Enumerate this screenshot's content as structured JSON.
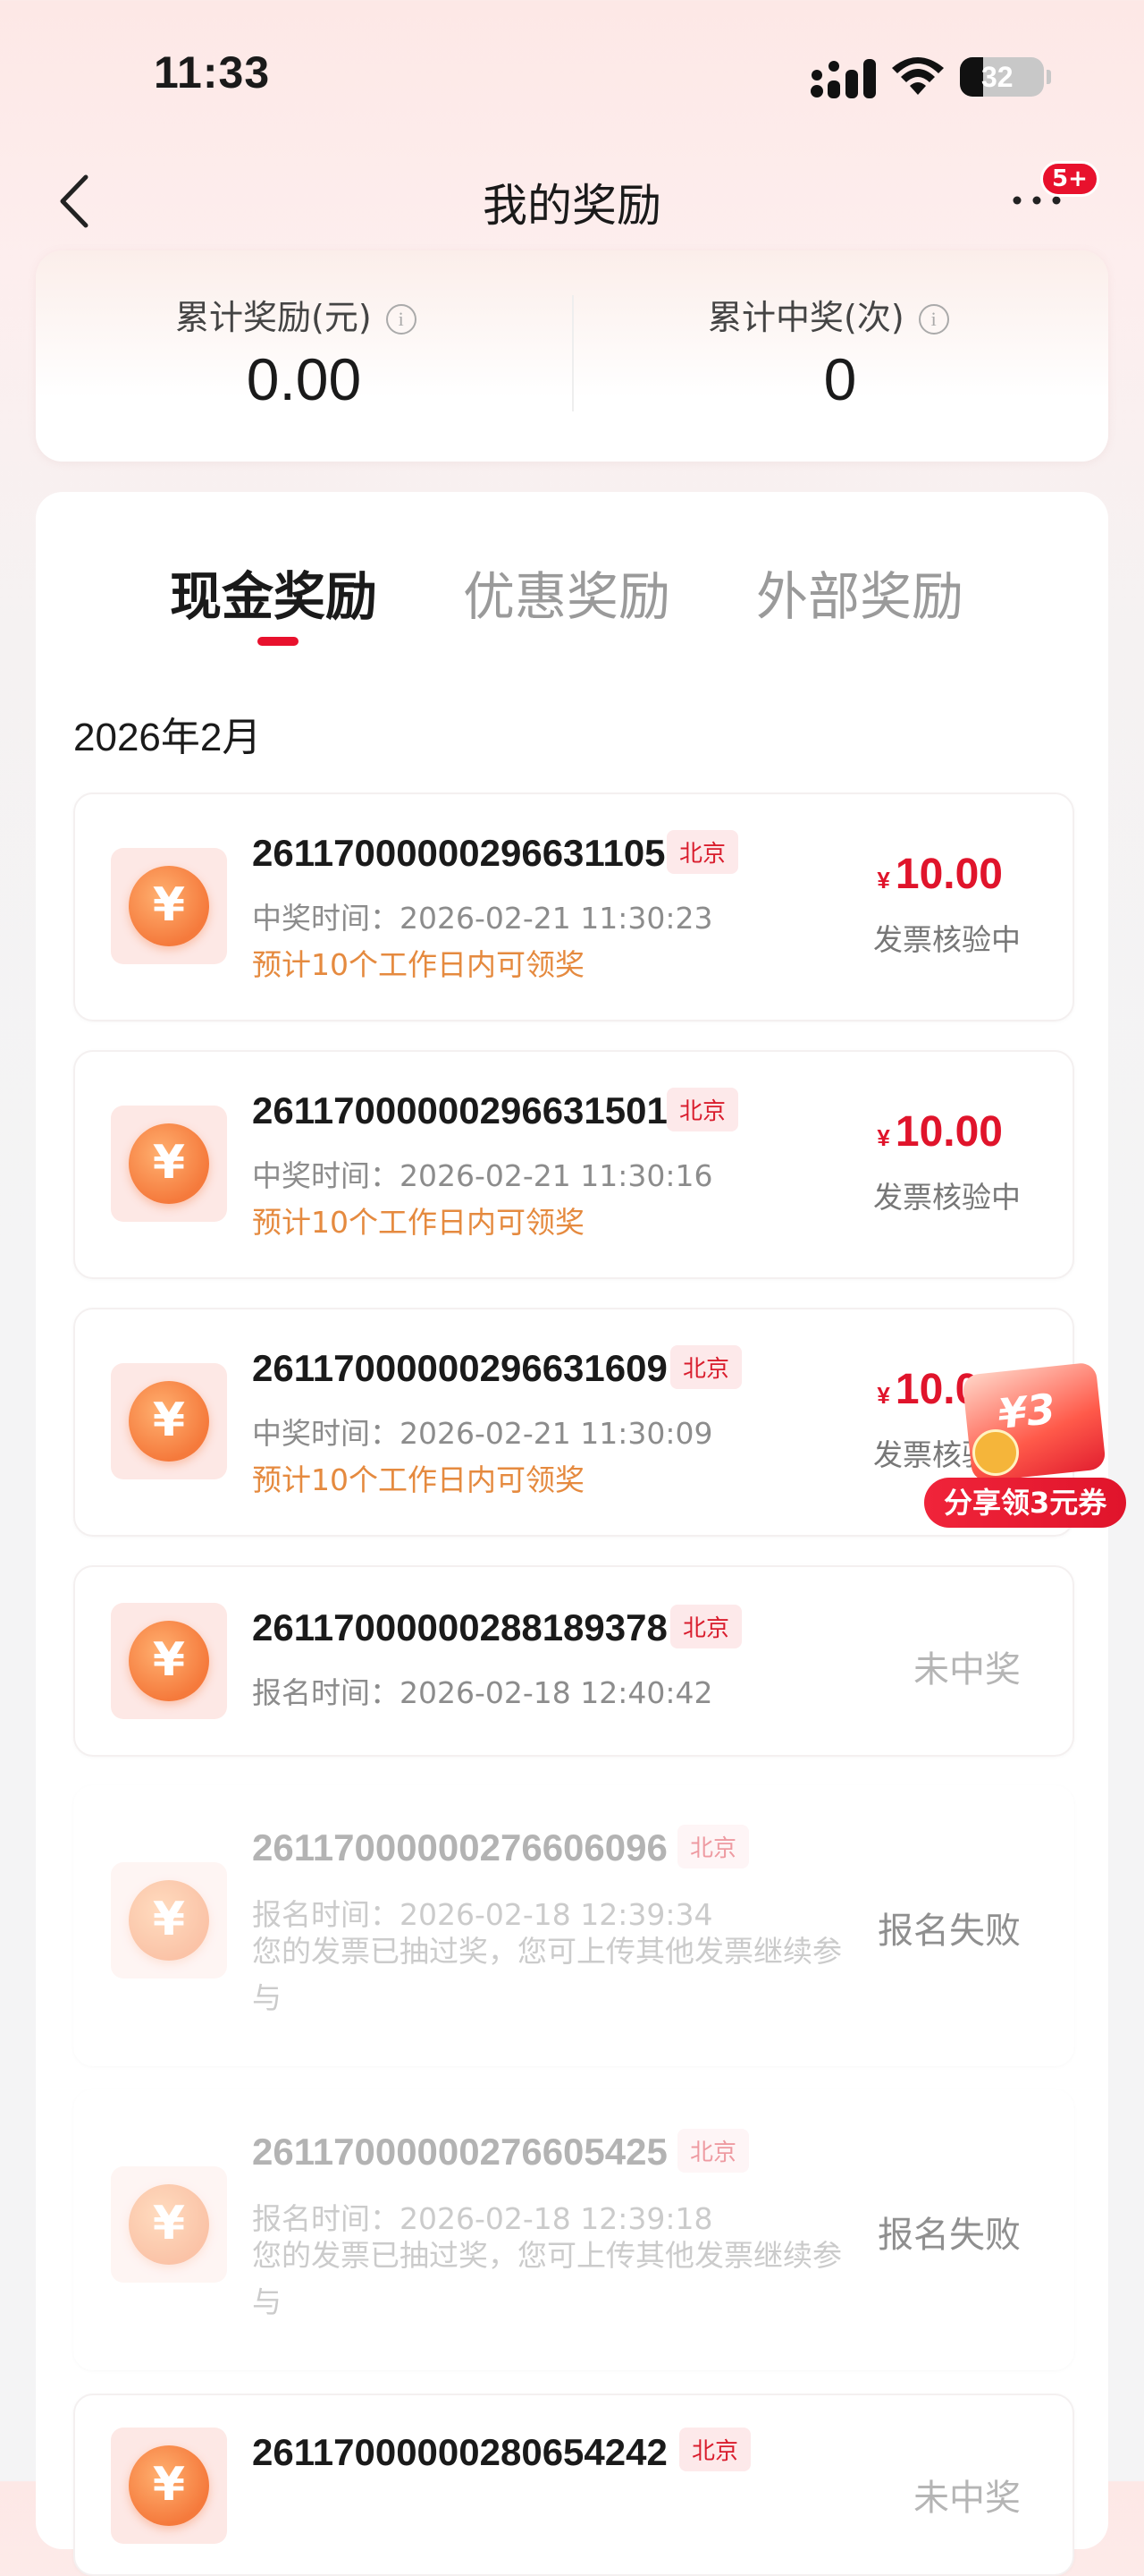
{
  "status_bar": {
    "time": "11:33",
    "battery": "32"
  },
  "nav": {
    "title": "我的奖励",
    "more_badge": "5+"
  },
  "summary": {
    "total_reward_label": "累计奖励(元)",
    "total_reward_value": "0.00",
    "total_wins_label": "累计中奖(次)",
    "total_wins_value": "0",
    "info_glyph": "i"
  },
  "tabs": [
    {
      "label": "现金奖励",
      "active": true
    },
    {
      "label": "优惠奖励",
      "active": false
    },
    {
      "label": "外部奖励",
      "active": false
    }
  ],
  "month": "2026年2月",
  "currency_symbol": "¥",
  "coin_glyph": "¥",
  "records": [
    {
      "id": "26117000000296631105",
      "city": "北京",
      "time_label": "中奖时间：",
      "time": "2026-02-21 11:30:23",
      "note": "预计10个工作日内可领奖",
      "amount": "10.00",
      "status": "发票核验中"
    },
    {
      "id": "26117000000296631501",
      "city": "北京",
      "time_label": "中奖时间：",
      "time": "2026-02-21 11:30:16",
      "note": "预计10个工作日内可领奖",
      "amount": "10.00",
      "status": "发票核验中"
    },
    {
      "id": "26117000000296631609",
      "city": "北京",
      "time_label": "中奖时间：",
      "time": "2026-02-21 11:30:09",
      "note": "预计10个工作日内可领奖",
      "amount": "10.00",
      "status": "发票核验中"
    },
    {
      "id": "26117000000288189378",
      "city": "北京",
      "time_label": "报名时间：",
      "time": "2026-02-18 12:40:42",
      "status": "未中奖"
    },
    {
      "id": "26117000000276606096",
      "city": "北京",
      "time_label": "报名时间：",
      "time": "2026-02-18 12:39:34",
      "note": "您的发票已抽过奖，您可上传其他发票继续参与",
      "status": "报名失败"
    },
    {
      "id": "26117000000276605425",
      "city": "北京",
      "time_label": "报名时间：",
      "time": "2026-02-18 12:39:18",
      "note": "您的发票已抽过奖，您可上传其他发票继续参与",
      "status": "报名失败"
    },
    {
      "id": "26117000000280654242",
      "city": "北京",
      "status": "未中奖"
    }
  ],
  "promo": {
    "gift_text": "¥3",
    "label": "分享领3元券"
  },
  "colors": {
    "accent": "#e8112d",
    "note_orange": "#e58a3f",
    "coin": "#f57a3c"
  },
  "icons": [
    "back-chevron-icon",
    "more-dots-icon",
    "info-icon",
    "coin-yuan-icon",
    "signal-icon",
    "wifi-icon",
    "battery-icon",
    "gift-icon"
  ]
}
